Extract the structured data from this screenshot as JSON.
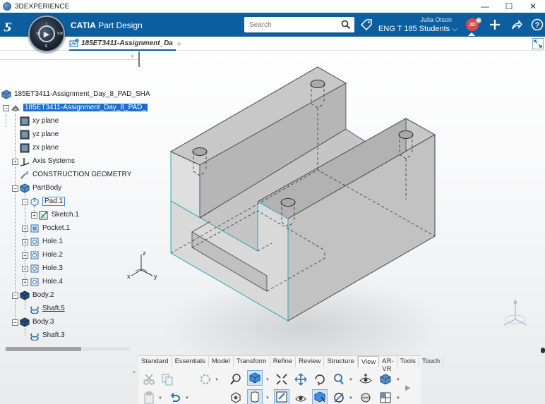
{
  "window": {
    "title": "3DEXPERIENCE",
    "controls": [
      "—",
      "☐",
      "✕"
    ]
  },
  "header": {
    "logo": "ƽ",
    "app_brand": "CATIA",
    "app_name": "Part Design",
    "search_placeholder": "Search",
    "user_name": "Julia Olson",
    "collab_space": "ENG T 185 Students",
    "avatar_initials": "JO",
    "accent_color": "#0d5e9e"
  },
  "tab_bar": {
    "doc_tab_label": "185ET3411-Assignment_Da",
    "doc_badge": "1",
    "add_tab": "+"
  },
  "tree": {
    "root_label": "185ET3411-Assignment_Day_8_PAD_SHA",
    "part_label": "185ET3411-Assignment_Day_8_PAD_",
    "nodes": [
      {
        "label": "xy plane"
      },
      {
        "label": "yz plane"
      },
      {
        "label": "zx plane"
      },
      {
        "label": "Axis Systems"
      },
      {
        "label": "CONSTRUCTION GEOMETRY"
      },
      {
        "label": "PartBody"
      },
      {
        "label": "Pad.1"
      },
      {
        "label": "Sketch.1"
      },
      {
        "label": "Pocket.1"
      },
      {
        "label": "Hole.1"
      },
      {
        "label": "Hole.2"
      },
      {
        "label": "Hole.3"
      },
      {
        "label": "Hole.4"
      },
      {
        "label": "Body.2"
      },
      {
        "label": "Shaft.5"
      },
      {
        "label": "Body.3"
      },
      {
        "label": "Shaft.3"
      }
    ]
  },
  "axis_labels": {
    "z": "z",
    "x": "x",
    "y": "y"
  },
  "action_bar": {
    "tabs": [
      "Standard",
      "Essentials",
      "Model",
      "Transform",
      "Refine",
      "Review",
      "Structure",
      "View",
      "AR-VR",
      "Tools",
      "Touch"
    ],
    "active_tab": "View"
  }
}
